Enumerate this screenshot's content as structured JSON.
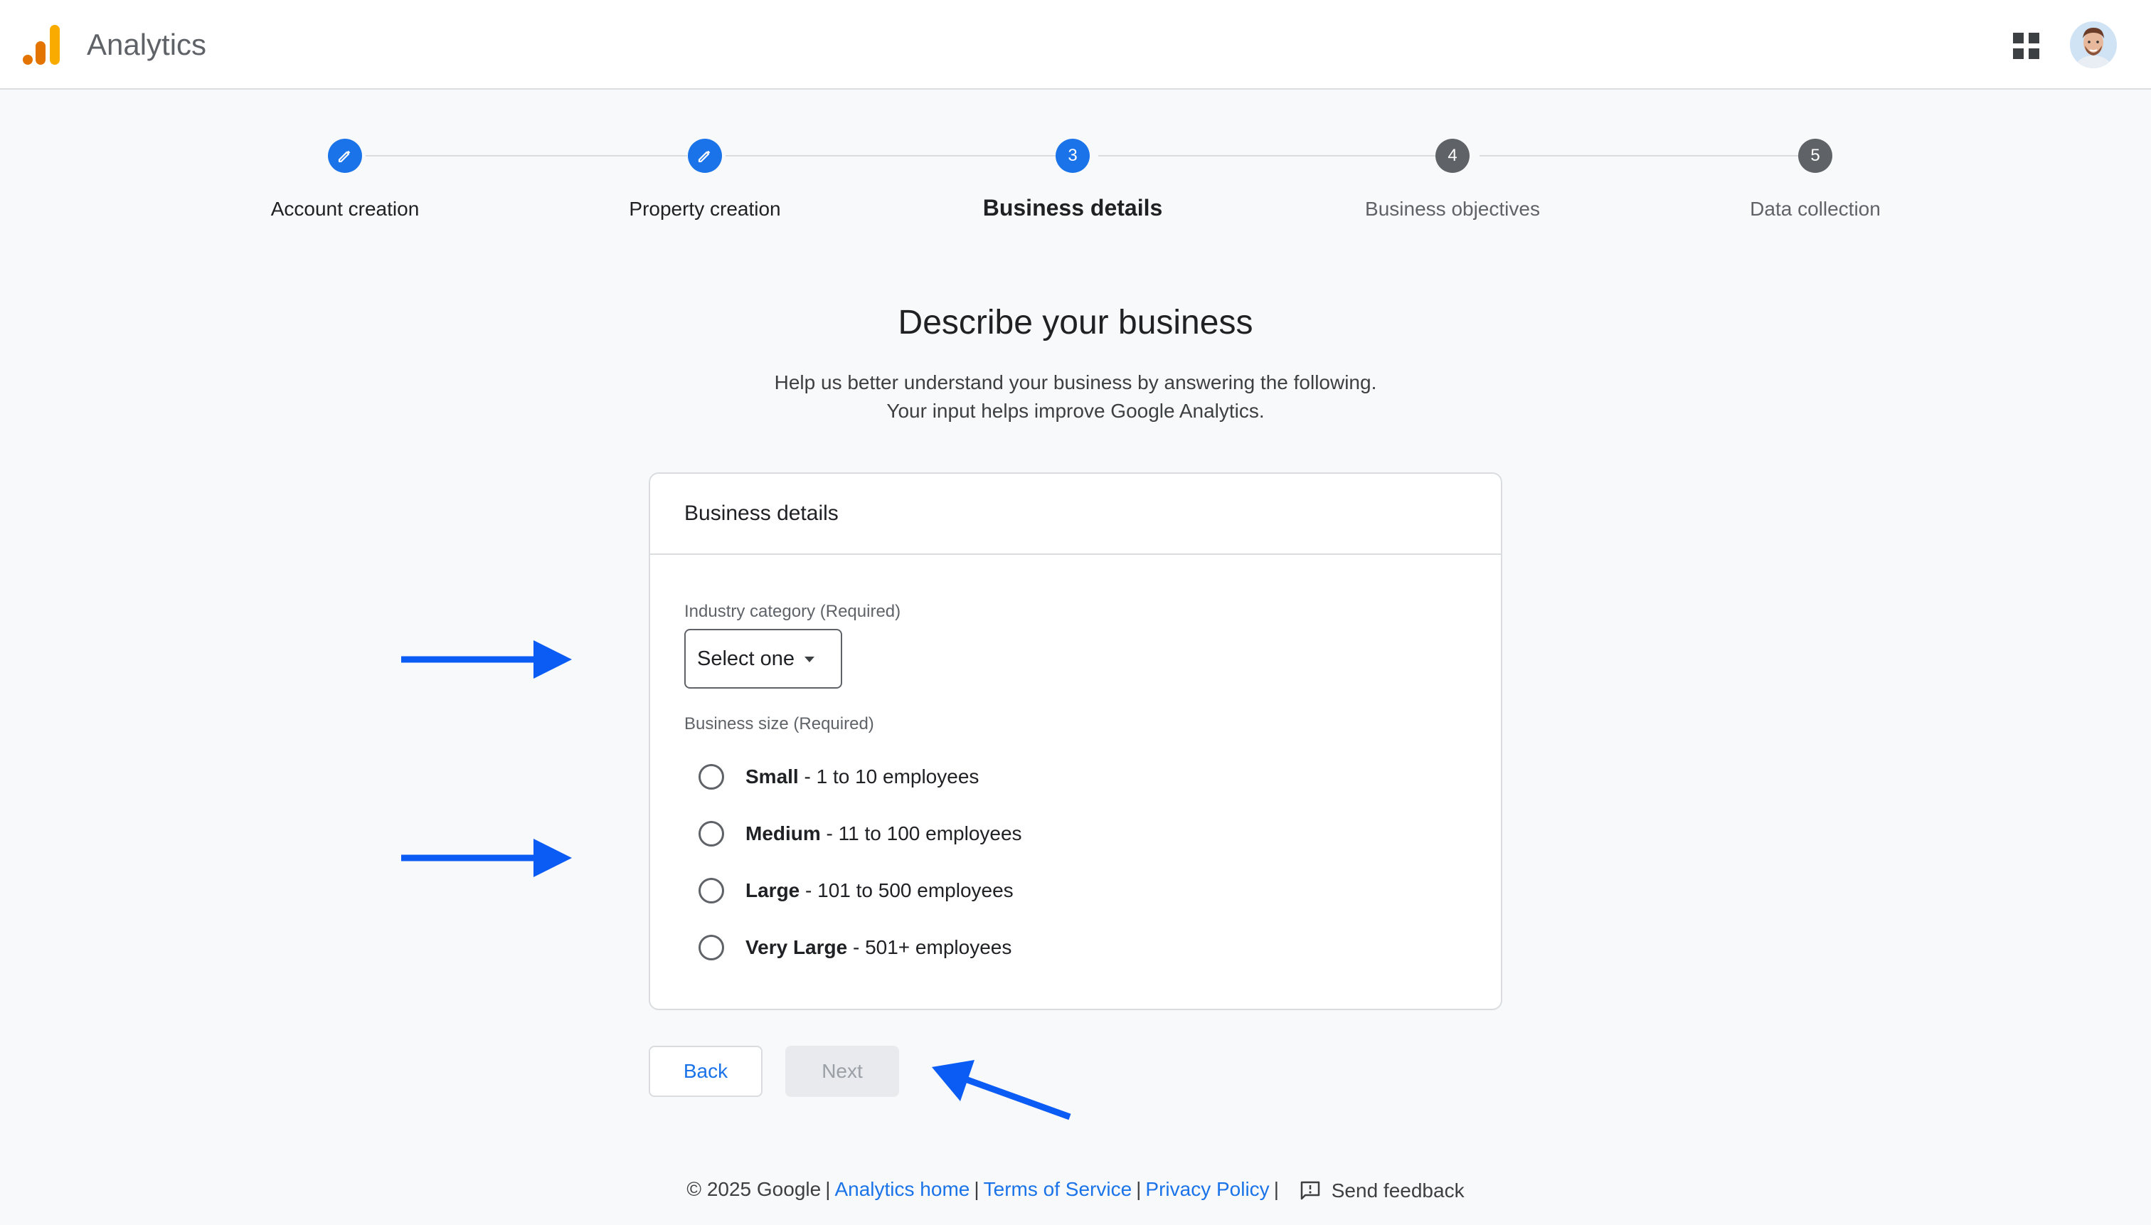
{
  "app": {
    "title": "Analytics",
    "logo_icon": "analytics-bars-icon",
    "apps_icon": "apps-grid-icon",
    "avatar_icon": "user-avatar"
  },
  "stepper": {
    "steps": [
      {
        "label": "Account creation",
        "state": "done",
        "marker": "edit-icon"
      },
      {
        "label": "Property creation",
        "state": "done",
        "marker": "edit-icon"
      },
      {
        "label": "Business details",
        "state": "active",
        "marker": "3"
      },
      {
        "label": "Business objectives",
        "state": "pending",
        "marker": "4"
      },
      {
        "label": "Data collection",
        "state": "pending",
        "marker": "5"
      }
    ]
  },
  "main": {
    "title": "Describe your business",
    "subtitle_line1": "Help us better understand your business by answering the following.",
    "subtitle_line2": "Your input helps improve Google Analytics."
  },
  "card": {
    "header": "Business details",
    "industry_label": "Industry category (Required)",
    "industry_value": "Select one",
    "size_label": "Business size (Required)",
    "sizes": [
      {
        "name": "Small",
        "detail": " - 1 to 10 employees"
      },
      {
        "name": "Medium",
        "detail": " - 11 to 100 employees"
      },
      {
        "name": "Large",
        "detail": " - 101 to 500 employees"
      },
      {
        "name": "Very Large",
        "detail": " - 501+ employees"
      }
    ]
  },
  "buttons": {
    "back": "Back",
    "next": "Next"
  },
  "footer": {
    "copyright": "© 2025 Google",
    "analytics_home": "Analytics home",
    "terms": "Terms of Service",
    "privacy": "Privacy Policy",
    "feedback": "Send feedback"
  },
  "colors": {
    "accent": "#1a73e8",
    "annotation_arrow": "#0b5cf5",
    "pending_step": "#5f6368"
  }
}
